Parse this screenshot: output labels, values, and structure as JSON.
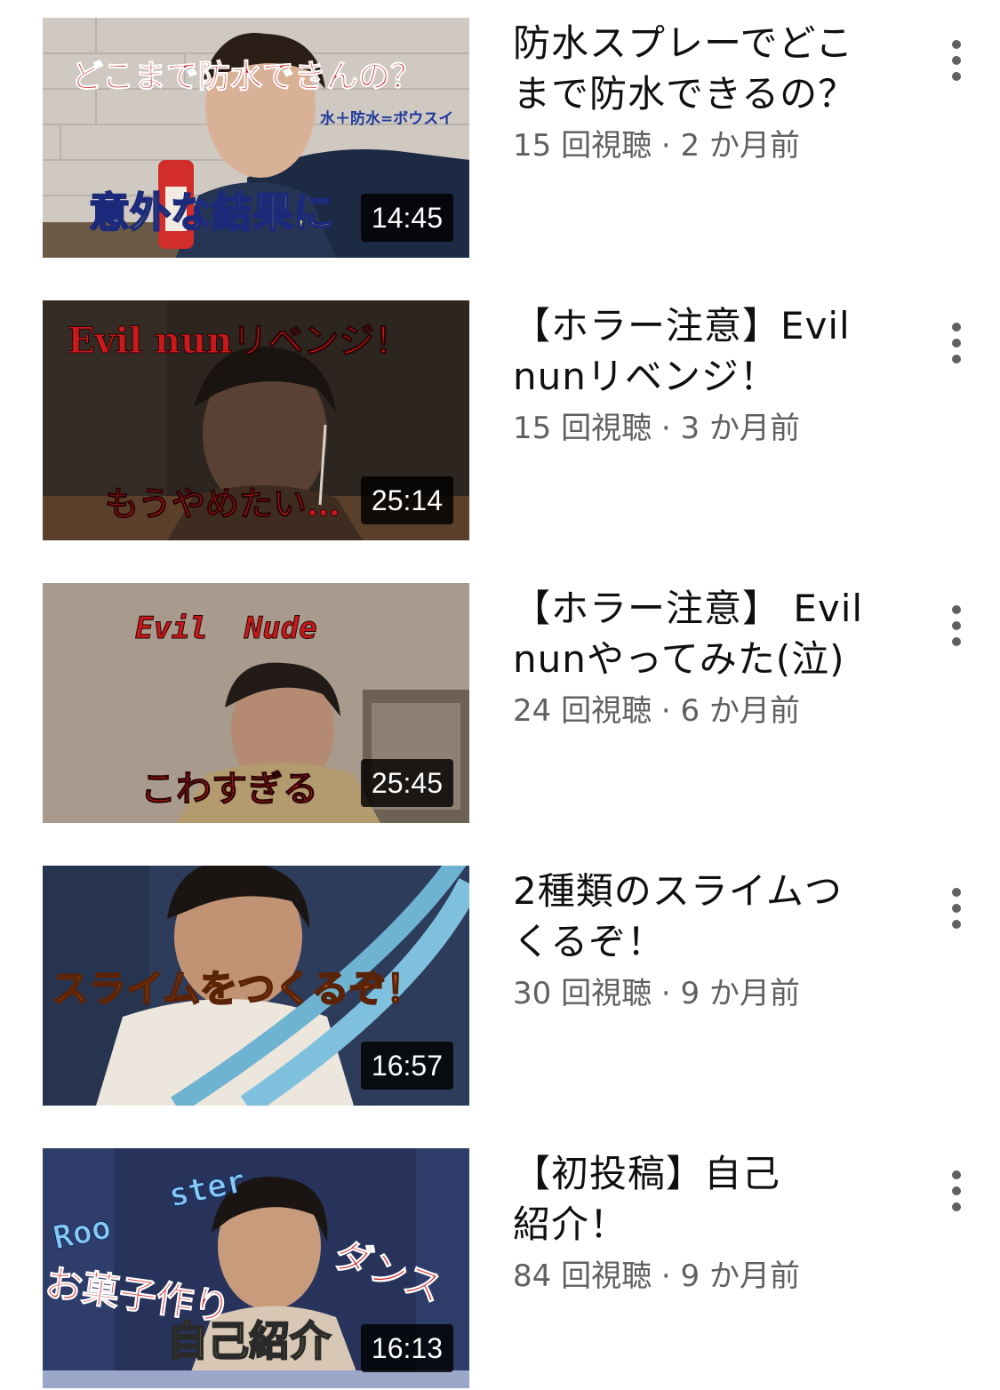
{
  "videos": [
    {
      "title_lines": [
        "防水スプレーでどこ",
        "まで防水できるの？"
      ],
      "views": "15 回視聴",
      "separator": "·",
      "age": "2 か月前",
      "duration": "14:45",
      "thumbnail_text": {
        "top": "どこまで防水できんの？",
        "small": "水＋防水=ボウスイ",
        "bottom": "意外な結果に"
      },
      "menu_icon": "more-vertical-icon"
    },
    {
      "title_lines": [
        "【ホラー注意】Evil",
        "nunリベンジ！"
      ],
      "views": "15 回視聴",
      "separator": "·",
      "age": "3 か月前",
      "duration": "25:14",
      "thumbnail_text": {
        "top": "Evil nunリベンジ！",
        "bottom": "もうやめたい…"
      },
      "menu_icon": "more-vertical-icon"
    },
    {
      "title_lines": [
        "【ホラー注意】 Evil",
        "nunやってみた(泣)"
      ],
      "views": "24 回視聴",
      "separator": "·",
      "age": "6 か月前",
      "duration": "25:45",
      "thumbnail_text": {
        "top": "Evil  Nude",
        "bottom": "こわすぎる"
      },
      "menu_icon": "more-vertical-icon"
    },
    {
      "title_lines": [
        "2種類のスライムつ",
        "くるぞ！"
      ],
      "views": "30 回視聴",
      "separator": "·",
      "age": "9 か月前",
      "duration": "16:57",
      "thumbnail_text": {
        "main": "スライムをつくるぞ！"
      },
      "menu_icon": "more-vertical-icon"
    },
    {
      "title_lines": [
        "【初投稿】自己",
        "紹介！"
      ],
      "views": "84 回視聴",
      "separator": "·",
      "age": "9 か月前",
      "duration": "16:13",
      "thumbnail_text": {
        "roo": "Roo",
        "ster": "ster",
        "dance": "ダンス",
        "sweets": "お菓子作り",
        "intro": "自己紹介"
      },
      "menu_icon": "more-vertical-icon"
    }
  ]
}
